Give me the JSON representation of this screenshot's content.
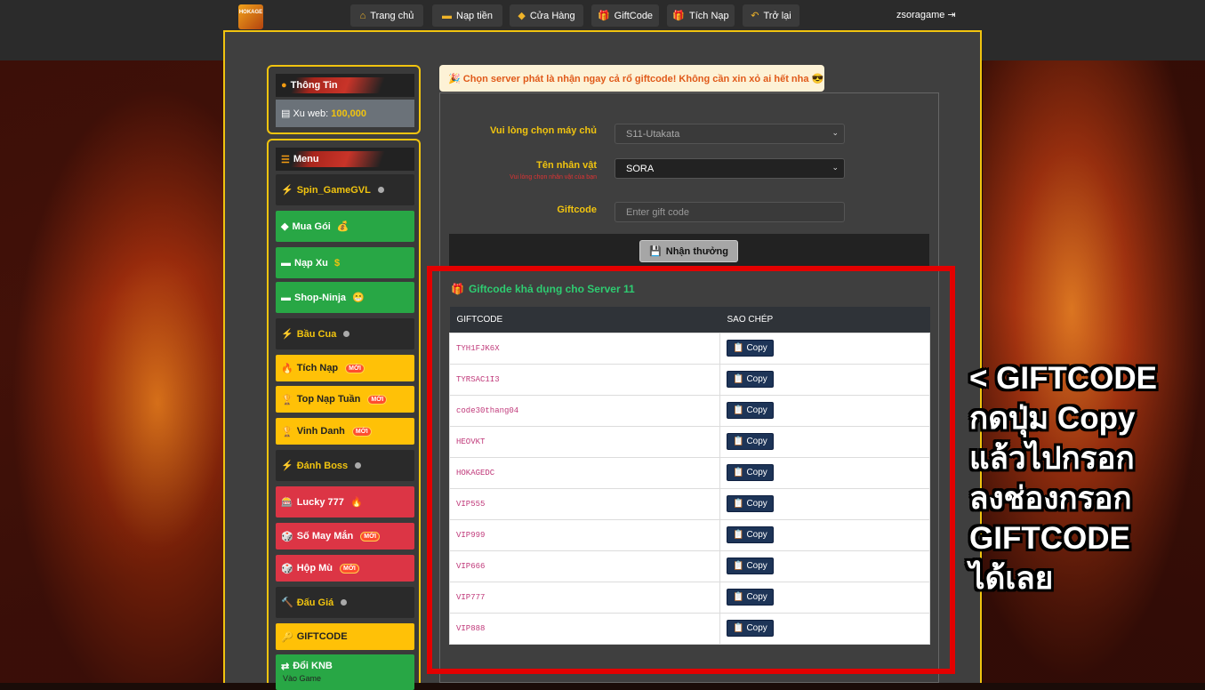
{
  "nav": {
    "logo_text": "HOKAGE",
    "items": [
      {
        "label": "Trang chủ",
        "icon": "home-icon"
      },
      {
        "label": "Nạp tiền",
        "icon": "card-icon"
      },
      {
        "label": "Cửa Hàng",
        "icon": "diamond-icon"
      },
      {
        "label": "GiftCode",
        "icon": "gift-icon"
      },
      {
        "label": "Tích Nạp",
        "icon": "gift-icon"
      },
      {
        "label": "Trở lại",
        "icon": "undo-icon"
      }
    ],
    "username": "zsoragame"
  },
  "info_panel": {
    "title": "Thông Tin",
    "xu_label": "Xu web:",
    "xu_value": "100,000"
  },
  "menu": {
    "title": "Menu",
    "items": [
      {
        "label": "Spin_GameGVL",
        "style": "dark"
      },
      {
        "label": "Mua Gói",
        "style": "green"
      },
      {
        "label": "Nạp Xu",
        "style": "green"
      },
      {
        "label": "Shop-Ninja",
        "style": "green"
      },
      {
        "label": "Bầu Cua",
        "style": "dark"
      },
      {
        "label": "Tích Nạp",
        "style": "yellow",
        "badge": "MỚI"
      },
      {
        "label": "Top Nạp Tuần",
        "style": "yellow",
        "badge": "MỚI"
      },
      {
        "label": "Vinh Danh",
        "style": "yellow",
        "badge": "MỚI"
      },
      {
        "label": "Đánh Boss",
        "style": "dark"
      },
      {
        "label": "Lucky 777",
        "style": "red"
      },
      {
        "label": "Số May Mắn",
        "style": "red",
        "badge": "MỚI"
      },
      {
        "label": "Hộp Mù",
        "style": "red",
        "badge": "MỚI"
      },
      {
        "label": "Đấu Giá",
        "style": "dark"
      },
      {
        "label": "GIFTCODE",
        "style": "yellow"
      },
      {
        "label": "Đổi KNB",
        "style": "green",
        "sub": "Vào Game"
      }
    ]
  },
  "notice": "🎉 Chọn server phát là nhận ngay cả rổ giftcode! Không cần xin xỏ ai hết nha 😎",
  "form": {
    "server_label": "Vui lòng chọn máy chủ",
    "server_value": "S11-Utakata",
    "char_label": "Tên nhân vật",
    "char_warning": "Vui lòng chọn nhân vật của bạn",
    "char_value": "SORA",
    "gift_label": "Giftcode",
    "gift_placeholder": "Enter gift code",
    "submit_label": "Nhận thưởng"
  },
  "giftcodes": {
    "title": "Giftcode khả dụng cho Server 11",
    "col_code": "GIFTCODE",
    "col_copy": "SAO CHÉP",
    "copy_label": "Copy",
    "rows": [
      "TYH1FJK6X",
      "TYRSAC1I3",
      "code30thang04",
      "HEOVKT",
      "HOKAGEDC",
      "VIP555",
      "VIP999",
      "VIP666",
      "VIP777",
      "VIP888"
    ]
  },
  "annotation": "< GIFTCODE\nกดปุ่ม Copy\nแล้วไปกรอก\nลงช่องกรอก\nGIFTCODE\nได้เลย",
  "colors": {
    "accent": "#f1c40f",
    "highlight_box": "#e30000",
    "code_text": "#c0397a"
  }
}
